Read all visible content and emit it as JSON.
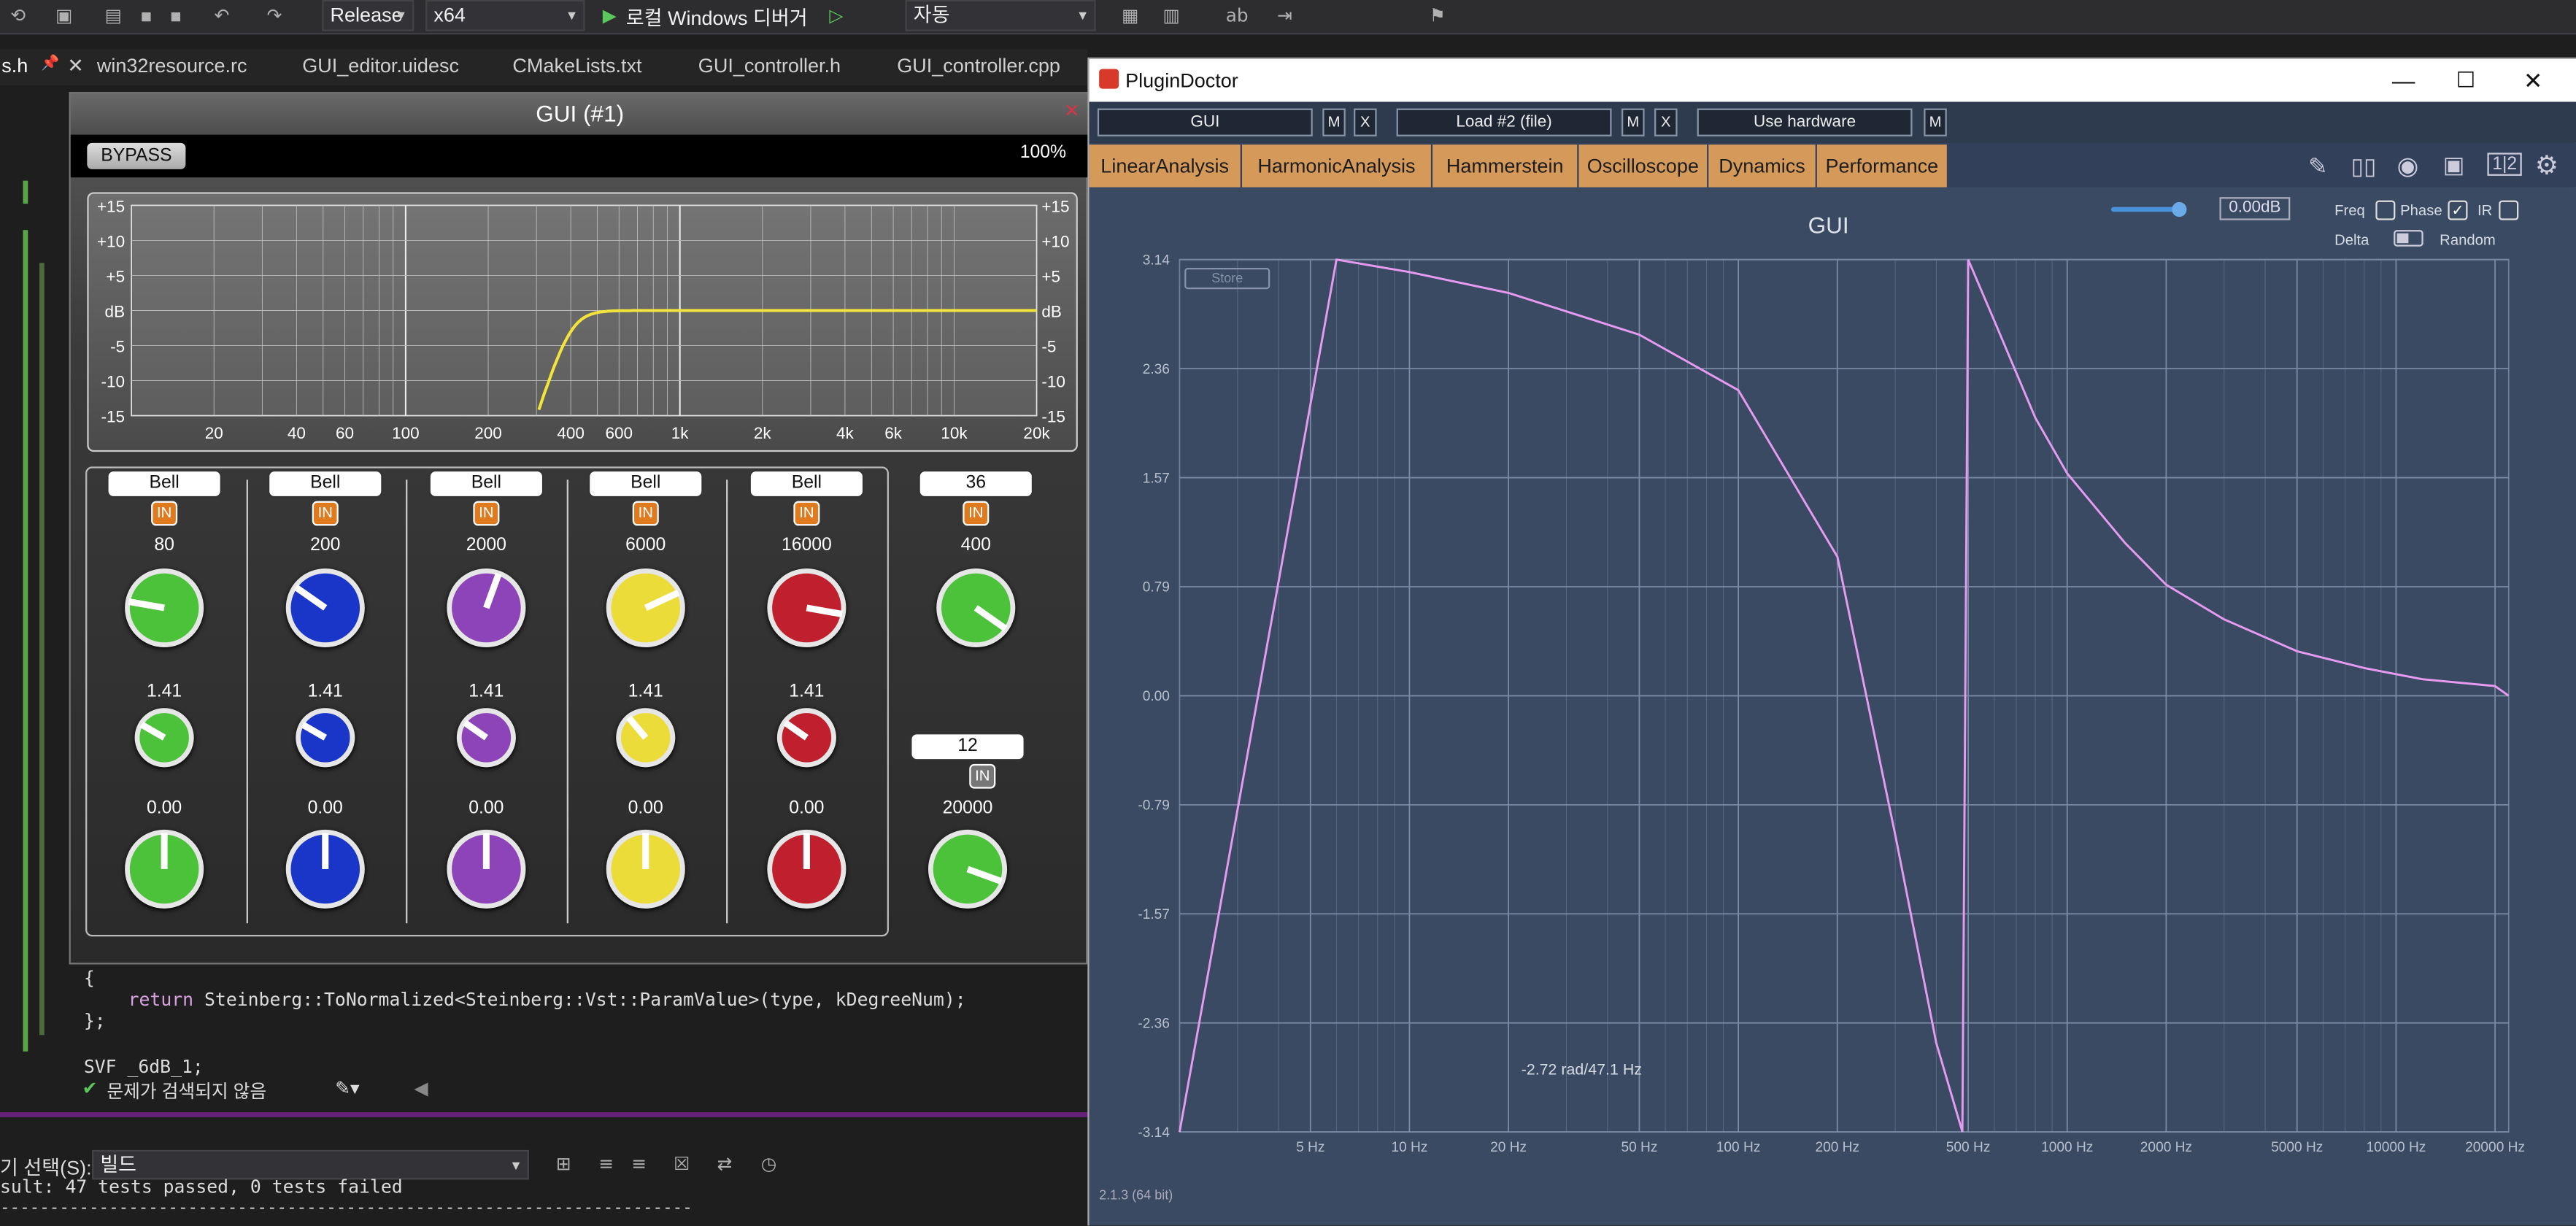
{
  "vs": {
    "config": "Release",
    "platform": "x64",
    "debugger": "로컬 Windows 디버거",
    "auto": "자동",
    "tabs": [
      "s.h",
      "win32resource.rc",
      "GUI_editor.uidesc",
      "CMakeLists.txt",
      "GUI_controller.h",
      "GUI_controller.cpp"
    ],
    "code": {
      "brace_open": "{",
      "return_kw": "return",
      "return_call": "Steinberg::ToNormalized<Steinberg::Vst::ParamValue>(type, kDegreeNum);",
      "brace_close": "};",
      "svf_decl": "SVF _6dB_1;"
    },
    "status_issues": "문제가 검색되지 않음",
    "output_label": "기 선택(S):",
    "output_source": "빌드",
    "output_line": "sult: 47 tests passed, 0 tests failed",
    "output_dash": "------------------------------------------------------------------------"
  },
  "gui": {
    "title": "GUI (#1)",
    "bypass": "BYPASS",
    "percent": "100%",
    "db_labels": [
      "+15",
      "+10",
      "+5",
      "dB",
      "-5",
      "-10",
      "-15"
    ],
    "freq_labels": [
      "20",
      "40",
      "60",
      "100",
      "200",
      "400",
      "600",
      "1k",
      "2k",
      "4k",
      "6k",
      "10k",
      "20k"
    ],
    "in_label": "IN",
    "bands": [
      {
        "type": "Bell",
        "freq": "80",
        "q": "1.41",
        "gain": "0.00",
        "color": "#4cc23a"
      },
      {
        "type": "Bell",
        "freq": "200",
        "q": "1.41",
        "gain": "0.00",
        "color": "#1a36c8"
      },
      {
        "type": "Bell",
        "freq": "2000",
        "q": "1.41",
        "gain": "0.00",
        "color": "#8c44b8"
      },
      {
        "type": "Bell",
        "freq": "6000",
        "q": "1.41",
        "gain": "0.00",
        "color": "#ecdc3a"
      },
      {
        "type": "Bell",
        "freq": "16000",
        "q": "1.41",
        "gain": "0.00",
        "color": "#c0202e"
      }
    ],
    "hp": {
      "slope": "36",
      "freq": "400",
      "color": "#4cc23a"
    },
    "lp": {
      "slope": "12",
      "freq": "20000",
      "color": "#4cc23a"
    }
  },
  "pd": {
    "window_title": "PluginDoctor",
    "slot1": "GUI",
    "slot2": "Load #2 (file)",
    "slot3": "Use hardware",
    "m": "M",
    "x": "X",
    "tabs": [
      "LinearAnalysis",
      "HarmonicAnalysis",
      "Hammerstein",
      "Oscilloscope",
      "Dynamics",
      "Performance"
    ],
    "gain_readout": "0.00dB",
    "opts": {
      "freq": "Freq",
      "phase": "Phase",
      "ir": "IR",
      "delta": "Delta",
      "random": "Random"
    },
    "store": "Store",
    "cursor_readout": "-2.72 rad/47.1 Hz",
    "version": "2.1.3 (64 bit)"
  },
  "chart_data": {
    "type": "line",
    "title": "GUI",
    "xlabel": "",
    "ylabel": "",
    "x_scale": "log",
    "x_ticks": [
      "5 Hz",
      "10 Hz",
      "20 Hz",
      "50 Hz",
      "100 Hz",
      "200 Hz",
      "500 Hz",
      "1000 Hz",
      "2000 Hz",
      "5000 Hz",
      "10000 Hz",
      "20000 Hz"
    ],
    "y_ticks": [
      "3.14",
      "2.36",
      "1.57",
      "0.79",
      "0.00",
      "-0.79",
      "-1.57",
      "-2.36",
      "-3.14"
    ],
    "xlim": [
      2,
      22000
    ],
    "ylim": [
      -3.14,
      3.14
    ],
    "series": [
      {
        "x": [
          2,
          6,
          10,
          20,
          50,
          100,
          200,
          300,
          400,
          480
        ],
        "y": [
          -3.14,
          3.14,
          3.05,
          2.9,
          2.6,
          2.2,
          1.0,
          -1.0,
          -2.5,
          -3.14
        ]
      },
      {
        "x": [
          500,
          600,
          800,
          1000,
          1500,
          2000,
          3000,
          5000,
          8000,
          12000,
          20000,
          22000
        ],
        "y": [
          3.14,
          2.7,
          2.0,
          1.6,
          1.1,
          0.8,
          0.55,
          0.32,
          0.2,
          0.12,
          0.07,
          0.0
        ]
      }
    ],
    "color": "#e79bf0",
    "grid": true
  }
}
